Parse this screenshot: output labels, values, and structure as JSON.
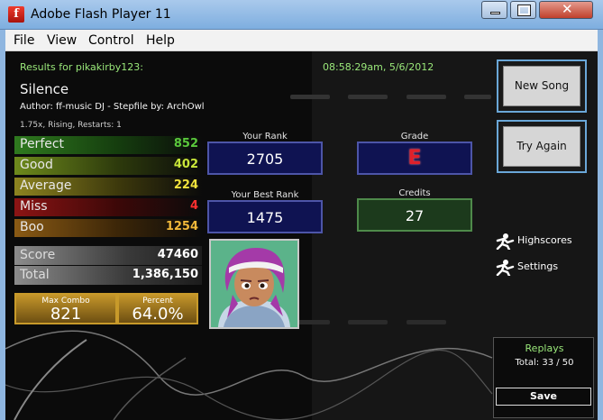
{
  "window": {
    "title": "Adobe Flash Player 11",
    "menu": [
      "File",
      "View",
      "Control",
      "Help"
    ]
  },
  "results": {
    "header": "Results for pikakirby123:",
    "timestamp": "08:58:29am, 5/6/2012",
    "song": "Silence",
    "author_line": "Author: ff-music DJ   -   Stepfile by: ArchOwl",
    "mods": "1.75x, Rising, Restarts: 1"
  },
  "judgements": [
    {
      "name": "Perfect",
      "value": "852",
      "color": "#5ac83c"
    },
    {
      "name": "Good",
      "value": "402",
      "color": "#c9e63a"
    },
    {
      "name": "Average",
      "value": "224",
      "color": "#f1e23c"
    },
    {
      "name": "Miss",
      "value": "4",
      "color": "#ff3030"
    },
    {
      "name": "Boo",
      "value": "1254",
      "color": "#f1b83a"
    }
  ],
  "totals": {
    "score_label": "Score",
    "score": "47460",
    "total_label": "Total",
    "total": "1,386,150"
  },
  "combo": {
    "max_label": "Max Combo",
    "max": "821",
    "percent_label": "Percent",
    "percent": "64.0%"
  },
  "rank": {
    "your_rank_label": "Your Rank",
    "your_rank": "2705",
    "best_rank_label": "Your Best Rank",
    "best_rank": "1475",
    "grade_label": "Grade",
    "grade": "E",
    "credits_label": "Credits",
    "credits": "27"
  },
  "sidebar": {
    "new_song": "New Song",
    "try_again": "Try Again",
    "highscores": "Highscores",
    "settings": "Settings"
  },
  "replays": {
    "title": "Replays",
    "total": "Total: 33 / 50",
    "save": "Save"
  },
  "colors": {
    "accent_green": "#9ae87a",
    "stat_blue": "#0f1352",
    "grade_red": "#e0202a"
  }
}
